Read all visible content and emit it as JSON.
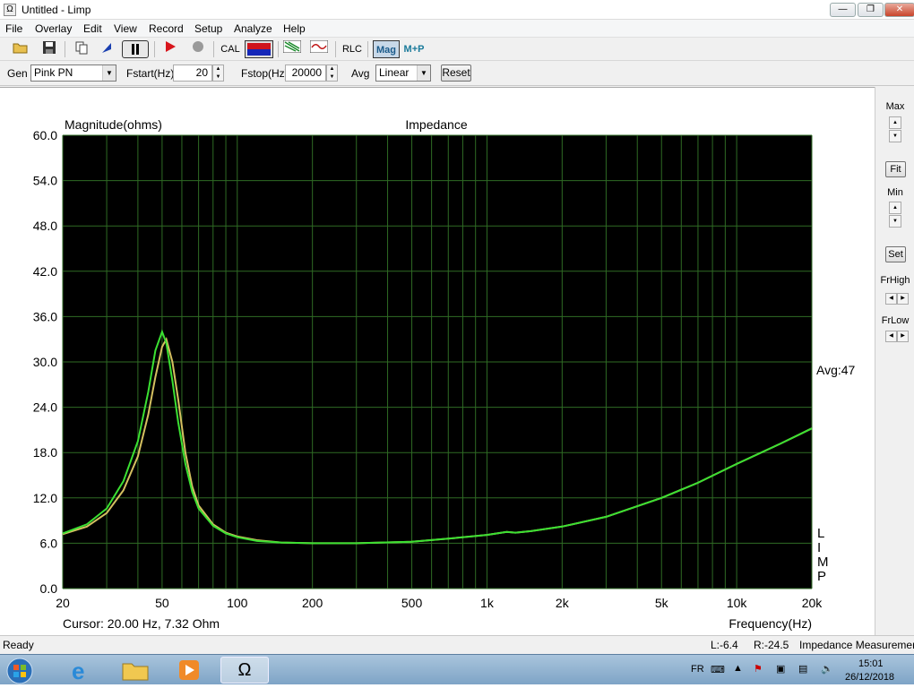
{
  "window": {
    "title": "Untitled - Limp",
    "app_icon": "Ω",
    "min_label": "—",
    "max_label": "❐",
    "close_label": "✕"
  },
  "menu": [
    "File",
    "Overlay",
    "Edit",
    "View",
    "Record",
    "Setup",
    "Analyze",
    "Help"
  ],
  "toolbar": {
    "cal": "CAL",
    "rlc": "RLC",
    "mag": "Mag",
    "mp": "M+P"
  },
  "controls": {
    "gen_label": "Gen",
    "gen_value": "Pink PN",
    "fstart_label": "Fstart(Hz)",
    "fstart_value": "20",
    "fstop_label": "Fstop(Hz)",
    "fstop_value": "20000",
    "avg_label": "Avg",
    "avg_value": "Linear",
    "reset_label": "Reset"
  },
  "side": {
    "max": "Max",
    "fit": "Fit",
    "min": "Min",
    "set": "Set",
    "frhigh": "FrHigh",
    "frlow": "FrLow"
  },
  "status": {
    "ready": "Ready",
    "l": "L:-6.4",
    "r": "R:-24.5",
    "mode": "Impedance Measuremen"
  },
  "taskbar": {
    "lang": "FR",
    "time": "15:01",
    "date": "26/12/2018",
    "limp_icon": "Ω"
  },
  "chart_data": {
    "type": "line",
    "title": "Impedance",
    "ylabel": "Magnitude(ohms)",
    "xlabel": "Frequency(Hz)",
    "xscale": "log",
    "xlim": [
      20,
      20000
    ],
    "ylim": [
      0,
      60
    ],
    "y_ticks": [
      "60.0",
      "54.0",
      "48.0",
      "42.0",
      "36.0",
      "30.0",
      "24.0",
      "18.0",
      "12.0",
      "6.0",
      "0.0"
    ],
    "x_tick_labels": [
      {
        "value": 20,
        "label": "20"
      },
      {
        "value": 50,
        "label": "50"
      },
      {
        "value": 100,
        "label": "100"
      },
      {
        "value": 200,
        "label": "200"
      },
      {
        "value": 500,
        "label": "500"
      },
      {
        "value": 1000,
        "label": "1k"
      },
      {
        "value": 2000,
        "label": "2k"
      },
      {
        "value": 5000,
        "label": "5k"
      },
      {
        "value": 10000,
        "label": "10k"
      },
      {
        "value": 20000,
        "label": "20k"
      }
    ],
    "grid": true,
    "avg_label": "Avg:47",
    "side_letters": [
      "L",
      "I",
      "M",
      "P"
    ],
    "cursor": "Cursor: 20.00 Hz, 7.32 Ohm",
    "series": [
      {
        "color": "#d4c060",
        "x": [
          20,
          25,
          30,
          35,
          40,
          44,
          47,
          50,
          52,
          55,
          58,
          62,
          66,
          70,
          80,
          90,
          100,
          120,
          150,
          200,
          300,
          500,
          700,
          1000,
          1200,
          1300,
          1500,
          2000,
          3000,
          5000,
          7000,
          10000,
          15000,
          20000
        ],
        "y": [
          7.2,
          8.2,
          10.0,
          13.0,
          17.5,
          23.0,
          28.0,
          32.0,
          33.0,
          30.0,
          25.0,
          18.0,
          13.5,
          11.0,
          8.5,
          7.4,
          6.9,
          6.4,
          6.1,
          6.0,
          6.0,
          6.2,
          6.6,
          7.1,
          7.5,
          7.4,
          7.6,
          8.2,
          9.5,
          12.0,
          14.0,
          16.5,
          19.2,
          21.2
        ]
      },
      {
        "color": "#3be032",
        "x": [
          20,
          25,
          30,
          35,
          40,
          44,
          47,
          50,
          52,
          55,
          58,
          62,
          66,
          70,
          80,
          90,
          100,
          120,
          150,
          200,
          300,
          500,
          700,
          1000,
          1200,
          1300,
          1500,
          2000,
          3000,
          5000,
          7000,
          10000,
          15000,
          20000
        ],
        "y": [
          7.3,
          8.5,
          10.6,
          14.2,
          19.5,
          26.0,
          31.5,
          34.0,
          32.5,
          27.5,
          22.0,
          16.5,
          12.8,
          10.6,
          8.3,
          7.3,
          6.8,
          6.3,
          6.1,
          6.0,
          6.0,
          6.2,
          6.6,
          7.1,
          7.5,
          7.4,
          7.6,
          8.2,
          9.5,
          12.0,
          14.0,
          16.5,
          19.2,
          21.2
        ]
      }
    ]
  }
}
